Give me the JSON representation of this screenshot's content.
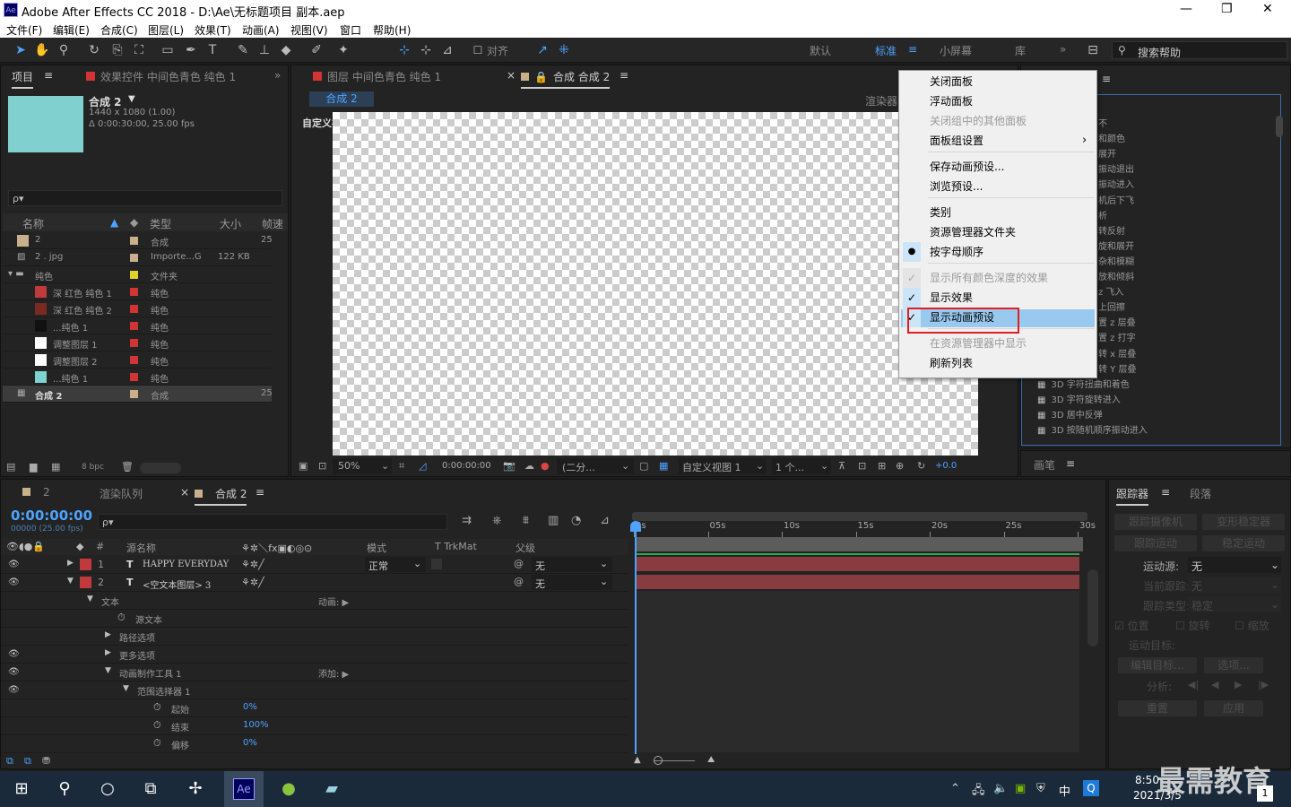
{
  "window": {
    "title": "Adobe After Effects CC 2018 - D:\\Ae\\无标题项目 副本.aep",
    "minimize": "—",
    "maximize": "❐",
    "close": "✕"
  },
  "menubar": [
    "文件(F)",
    "编辑(E)",
    "合成(C)",
    "图层(L)",
    "效果(T)",
    "动画(A)",
    "视图(V)",
    "窗口",
    "帮助(H)"
  ],
  "toolbar": {
    "snap_label": "对齐",
    "workspaces": [
      "默认",
      "标准",
      "小屏幕",
      "库"
    ],
    "active_workspace": "标准",
    "search_placeholder": "搜索帮助"
  },
  "project_panel": {
    "tabs": [
      "项目",
      "效果控件 中间色青色 纯色 1"
    ],
    "comp_name": "合成 2",
    "comp_res": "1440 x 1080 (1.00)",
    "comp_dur": "Δ 0:00:30:00, 25.00 fps",
    "search_placeholder": "ρ▾",
    "columns": [
      "名称",
      "类型",
      "大小",
      "帧速"
    ],
    "items": [
      {
        "name": "2",
        "type": "合成",
        "size": "",
        "fps": "25",
        "swatch": "#c8b08a",
        "label": "#c8b08a",
        "indent": 0,
        "icon": "comp"
      },
      {
        "name": "2 . jpg",
        "type": "Importe...G",
        "size": "122 KB",
        "fps": "",
        "swatch": "",
        "label": "#c8b08a",
        "indent": 0,
        "icon": "file"
      },
      {
        "name": "纯色",
        "type": "文件夹",
        "size": "",
        "fps": "",
        "swatch": "",
        "label": "#e0d030",
        "indent": 0,
        "icon": "folder"
      },
      {
        "name": "深 红色 纯色 1",
        "type": "纯色",
        "size": "",
        "fps": "",
        "swatch": "#c0393b",
        "label": "#d23434",
        "indent": 1
      },
      {
        "name": "深 红色 纯色 2",
        "type": "纯色",
        "size": "",
        "fps": "",
        "swatch": "#7a2a22",
        "label": "#d23434",
        "indent": 1
      },
      {
        "name": "...纯色 1",
        "type": "纯色",
        "size": "",
        "fps": "",
        "swatch": "#111111",
        "label": "#d23434",
        "indent": 1
      },
      {
        "name": "调整图层 1",
        "type": "纯色",
        "size": "",
        "fps": "",
        "swatch": "#ffffff",
        "label": "#d23434",
        "indent": 1
      },
      {
        "name": "调整图层 2",
        "type": "纯色",
        "size": "",
        "fps": "",
        "swatch": "#ffffff",
        "label": "#d23434",
        "indent": 1
      },
      {
        "name": "...纯色 1",
        "type": "纯色",
        "size": "",
        "fps": "",
        "swatch": "#7fd2d2",
        "label": "#d23434",
        "indent": 1
      },
      {
        "name": "合成 2",
        "type": "合成",
        "size": "",
        "fps": "25",
        "swatch": "",
        "label": "#c8b08a",
        "indent": 0,
        "icon": "comp",
        "selected": true
      }
    ],
    "bpc": "8 bpc"
  },
  "comp_panel": {
    "tabs": [
      "图层 中间色青色 纯色 1",
      "合成 合成 2"
    ],
    "sub_tab": "合成 2",
    "renderer": "渲染器",
    "view_label": "自定义视图 1",
    "footer": {
      "zoom": "50%",
      "time": "0:00:00:00",
      "resolution": "(二分...",
      "view": "自定义视图 1",
      "views": "1 个...",
      "exposure": "+0.0"
    }
  },
  "context_menu": {
    "items": [
      {
        "label": "关闭面板",
        "disabled": false
      },
      {
        "label": "浮动面板",
        "disabled": false
      },
      {
        "label": "关闭组中的其他面板",
        "disabled": true
      },
      {
        "label": "面板组设置",
        "disabled": false,
        "submenu": "›"
      },
      {
        "label": "保存动画预设...",
        "disabled": false
      },
      {
        "label": "浏览预设...",
        "disabled": false
      },
      {
        "label": "类别",
        "disabled": false
      },
      {
        "label": "资源管理器文件夹",
        "disabled": false
      },
      {
        "label": "按字母顺序",
        "disabled": false,
        "radio": true
      },
      {
        "label": "显示所有颜色深度的效果",
        "disabled": true,
        "check": true
      },
      {
        "label": "显示效果",
        "disabled": false,
        "check": true
      },
      {
        "label": "显示动画预设",
        "disabled": false,
        "check": true,
        "highlight": true
      },
      {
        "label": "在资源管理器中显示",
        "disabled": true
      },
      {
        "label": "刷新列表",
        "disabled": false
      }
    ]
  },
  "effects_panel": {
    "list": [
      "不",
      "和颜色",
      "展开",
      "振动退出",
      "振动进入",
      "机后下飞",
      "析",
      "转反射",
      "旋和展开",
      "杂和模糊",
      "放和倾斜",
      "z 飞入",
      "上回擦",
      "置 z 层叠",
      "置 z 打字",
      "转 x 层叠",
      "转 Y 层叠",
      "3D 字符扭曲和着色",
      "3D 字符旋转进入",
      "3D 居中反弹",
      "3D 按随机顺序振动进入"
    ]
  },
  "paragraph_panel": {
    "tab": "画笔"
  },
  "timeline": {
    "tabs": [
      "2",
      "渲染队列",
      "合成 2"
    ],
    "timecode": "0:00:00:00",
    "timecode_sub": "00000 (25.00 fps)",
    "search_placeholder": "ρ▾",
    "columns": {
      "source": "源名称",
      "mode": "模式",
      "trkmat": "T  TrkMat",
      "parent": "父级"
    },
    "layers": [
      {
        "num": "1",
        "name": "HAPPY EVERYDAY",
        "mode": "正常",
        "parent": "无"
      },
      {
        "num": "2",
        "name": "<空文本图层> 3",
        "mode": "",
        "parent": "无"
      }
    ],
    "props": [
      {
        "label": "文本",
        "indent": 1,
        "right": "动画: ▶"
      },
      {
        "label": "源文本",
        "indent": 2
      },
      {
        "label": "路径选项",
        "indent": 2
      },
      {
        "label": "更多选项",
        "indent": 2
      },
      {
        "label": "动画制作工具 1",
        "indent": 2,
        "right": "添加: ▶"
      },
      {
        "label": "范围选择器 1",
        "indent": 3
      },
      {
        "label": "起始",
        "indent": 4,
        "value": "0%"
      },
      {
        "label": "结束",
        "indent": 4,
        "value": "100%"
      },
      {
        "label": "偏移",
        "indent": 4,
        "value": "0%"
      }
    ],
    "ruler": [
      "0s",
      "05s",
      "10s",
      "15s",
      "20s",
      "25s",
      "30s"
    ]
  },
  "tracker": {
    "tabs": [
      "跟踪器",
      "段落"
    ],
    "buttons": [
      "跟踪摄像机",
      "变形稳定器",
      "跟踪运动",
      "稳定运动"
    ],
    "motion_source_label": "运动源:",
    "motion_source": "无",
    "current_track_label": "当前跟踪:",
    "current_track": "无",
    "track_type_label": "跟踪类型:",
    "track_type": "稳定",
    "checks": [
      "位置",
      "旋转",
      "缩放"
    ],
    "motion_target_label": "运动目标:",
    "edit_target": "编辑目标...",
    "options": "选项...",
    "analyze_label": "分析:",
    "reset": "重置",
    "apply": "应用"
  },
  "taskbar": {
    "time": "8:50",
    "date": "2021/3/5",
    "ime": "中",
    "watermark": "最需教育",
    "notification": "1"
  }
}
